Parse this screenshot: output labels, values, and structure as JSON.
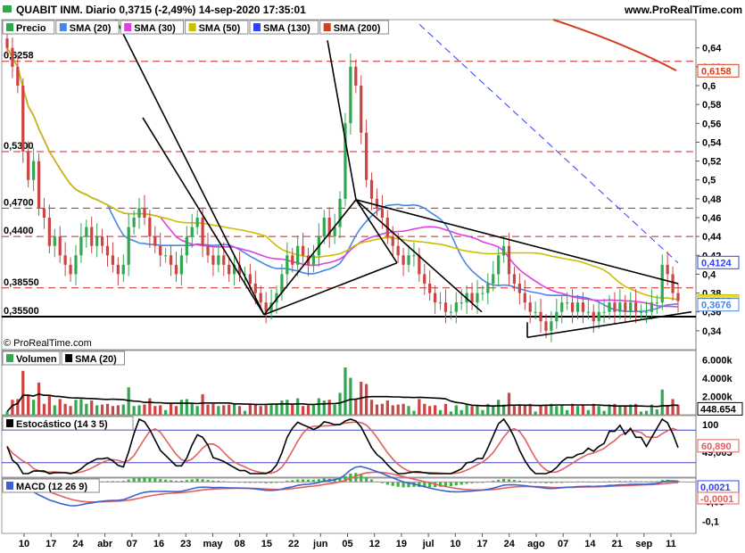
{
  "header": {
    "title": "QUABIT INM. Diario 0,3715 (-2,49%) 14-sep-2020 17:35:01",
    "site": "www.ProRealTime.com",
    "copyright": "© ProRealTime.com"
  },
  "colors": {
    "up": "#2fa84f",
    "down": "#cc4444",
    "sma20": "#4a86e8",
    "sma30": "#e040e0",
    "sma50": "#c8c000",
    "sma130": "#3040ff",
    "sma200": "#d04020",
    "hline": "#cc2222",
    "trend": "#000000",
    "stoch_k": "#000000",
    "stoch_d": "#e06060",
    "macd": "#4060d0",
    "signal": "#e06060",
    "hist": "#33bb33"
  },
  "legends": {
    "price": [
      {
        "label": "Precio",
        "color": "#2fa84f",
        "icon": "candle-icon"
      },
      {
        "label": "SMA (20)",
        "color": "#4a86e8"
      },
      {
        "label": "SMA (30)",
        "color": "#e040e0"
      },
      {
        "label": "SMA (50)",
        "color": "#c8c000"
      },
      {
        "label": "SMA (130)",
        "color": "#3040ff"
      },
      {
        "label": "SMA (200)",
        "color": "#d04020"
      }
    ],
    "volume": [
      {
        "label": "Volumen",
        "color": "#2fa84f",
        "icon": "bars-icon"
      },
      {
        "label": "SMA (20)",
        "color": "#000000"
      }
    ],
    "stoch": [
      {
        "label": "Estocástico (14 3 5)",
        "color": "#000000"
      }
    ],
    "macd": [
      {
        "label": "MACD (12 26 9)",
        "color": "#4060d0"
      }
    ]
  },
  "chart_data": [
    {
      "id": "price",
      "type": "candlestick",
      "ylim": [
        0.32,
        0.67
      ],
      "y_ticks": [
        "0,64",
        "0,62",
        "0,6",
        "0,58",
        "0,56",
        "0,54",
        "0,52",
        "0,5",
        "0,48",
        "0,46",
        "0,44",
        "0,42",
        "0,4",
        "0,38",
        "0,36",
        "0,34"
      ],
      "y_tick_values": [
        0.64,
        0.62,
        0.6,
        0.58,
        0.56,
        0.54,
        0.52,
        0.5,
        0.48,
        0.46,
        0.44,
        0.42,
        0.4,
        0.38,
        0.36,
        0.34
      ],
      "horizontal_levels": [
        {
          "value": 0.6258,
          "label": "0,6258"
        },
        {
          "value": 0.53,
          "label": "0,5300"
        },
        {
          "value": 0.47,
          "label": "0,4700"
        },
        {
          "value": 0.44,
          "label": "0,4400"
        },
        {
          "value": 0.3855,
          "label": "0,38550"
        },
        {
          "value": 0.355,
          "label": "0,35500"
        }
      ],
      "support_line": 0.355,
      "value_tags": [
        {
          "value": 0.6158,
          "label": "0,6158",
          "color": "#d04020"
        },
        {
          "value": 0.4124,
          "label": "0,4124",
          "color": "#3040ff"
        },
        {
          "value": 0.3715,
          "label": "0,3715",
          "color": "#c8c000",
          "highlight": true
        },
        {
          "value": 0.3676,
          "label": "0,3676",
          "color": "#4a86e8"
        }
      ],
      "x_labels": [
        "10",
        "17",
        "24",
        "abr",
        "07",
        "16",
        "23",
        "may",
        "08",
        "15",
        "22",
        "jun",
        "05",
        "12",
        "19",
        "jul",
        "10",
        "17",
        "24",
        "ago",
        "07",
        "14",
        "21",
        "sep",
        "11"
      ],
      "closes": [
        0.64,
        0.62,
        0.6,
        0.53,
        0.5,
        0.52,
        0.47,
        0.46,
        0.43,
        0.44,
        0.42,
        0.41,
        0.4,
        0.42,
        0.44,
        0.45,
        0.43,
        0.44,
        0.43,
        0.42,
        0.41,
        0.4,
        0.41,
        0.45,
        0.46,
        0.47,
        0.46,
        0.44,
        0.43,
        0.42,
        0.42,
        0.41,
        0.4,
        0.42,
        0.44,
        0.45,
        0.46,
        0.43,
        0.42,
        0.41,
        0.42,
        0.41,
        0.4,
        0.41,
        0.4,
        0.4,
        0.39,
        0.38,
        0.37,
        0.36,
        0.37,
        0.38,
        0.4,
        0.42,
        0.41,
        0.43,
        0.42,
        0.41,
        0.42,
        0.44,
        0.46,
        0.44,
        0.45,
        0.48,
        0.56,
        0.62,
        0.6,
        0.55,
        0.5,
        0.48,
        0.47,
        0.46,
        0.44,
        0.43,
        0.42,
        0.41,
        0.42,
        0.42,
        0.4,
        0.39,
        0.38,
        0.37,
        0.37,
        0.36,
        0.36,
        0.37,
        0.37,
        0.38,
        0.37,
        0.38,
        0.38,
        0.39,
        0.4,
        0.42,
        0.43,
        0.4,
        0.39,
        0.38,
        0.37,
        0.36,
        0.36,
        0.35,
        0.34,
        0.35,
        0.36,
        0.37,
        0.37,
        0.36,
        0.37,
        0.36,
        0.36,
        0.35,
        0.36,
        0.36,
        0.37,
        0.36,
        0.37,
        0.36,
        0.37,
        0.36,
        0.36,
        0.36,
        0.37,
        0.37,
        0.41,
        0.4,
        0.38,
        0.3715
      ]
    },
    {
      "id": "volume",
      "type": "bar",
      "y_ticks": [
        "6.000k",
        "4.000k",
        "2.000k"
      ],
      "y_tick_values": [
        6000,
        4000,
        2000
      ],
      "ylim": [
        0,
        7000
      ],
      "value_tags": [
        {
          "value": 448.654,
          "label": "448.654"
        }
      ]
    },
    {
      "id": "stochastic",
      "type": "line",
      "y_ticks": [
        "100",
        "49,005"
      ],
      "y_tick_values": [
        100,
        49.005
      ],
      "ylim": [
        0,
        100
      ],
      "value_tags": [
        {
          "value": 60.89,
          "label": "60,890",
          "color": "#e06060"
        }
      ]
    },
    {
      "id": "macd",
      "type": "line",
      "y_ticks": [
        "-0,05",
        "-0,1"
      ],
      "y_tick_values": [
        -0.05,
        -0.1
      ],
      "ylim": [
        -0.13,
        0.01
      ],
      "value_tags": [
        {
          "value": 0.0021,
          "label": "0,0021",
          "color": "#3040ff"
        },
        {
          "value": -0.0001,
          "label": "-0,0001",
          "color": "#e06060"
        }
      ]
    }
  ]
}
